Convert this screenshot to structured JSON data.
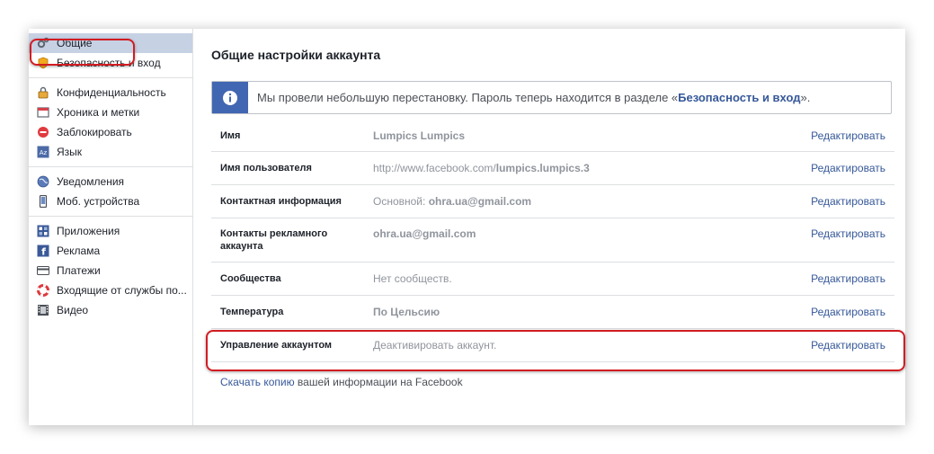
{
  "sidebar": {
    "groups": [
      [
        {
          "label": "Общие",
          "icon": "gear-icon",
          "active": true
        },
        {
          "label": "Безопасность и вход",
          "icon": "shield-icon"
        }
      ],
      [
        {
          "label": "Конфиденциальность",
          "icon": "lock-icon"
        },
        {
          "label": "Хроника и метки",
          "icon": "timeline-icon"
        },
        {
          "label": "Заблокировать",
          "icon": "block-icon"
        },
        {
          "label": "Язык",
          "icon": "language-icon"
        }
      ],
      [
        {
          "label": "Уведомления",
          "icon": "globe-icon"
        },
        {
          "label": "Моб. устройства",
          "icon": "phone-icon"
        }
      ],
      [
        {
          "label": "Приложения",
          "icon": "apps-icon"
        },
        {
          "label": "Реклама",
          "icon": "ads-icon"
        },
        {
          "label": "Платежи",
          "icon": "card-icon"
        },
        {
          "label": "Входящие от службы по...",
          "icon": "lifebuoy-icon"
        },
        {
          "label": "Видео",
          "icon": "film-icon"
        }
      ]
    ]
  },
  "main": {
    "title": "Общие настройки аккаунта",
    "notice": {
      "text_before": "Мы провели небольшую перестановку. Пароль теперь находится в разделе «",
      "link": "Безопасность и вход",
      "text_after": "».",
      "icon": "info-icon"
    },
    "edit_label": "Редактировать",
    "rows": [
      {
        "label": "Имя",
        "value": "Lumpics Lumpics"
      },
      {
        "label": "Имя пользователя",
        "value_prefix": "http://www.facebook.com/",
        "value_bold": "lumpics.lumpics.3"
      },
      {
        "label": "Контактная информация",
        "value_prefix": "Основной: ",
        "value_bold": "ohra.ua@gmail.com"
      },
      {
        "label": "Контакты рекламного аккаунта",
        "value": "ohra.ua@gmail.com"
      },
      {
        "label": "Сообщества",
        "value": "Нет сообществ."
      },
      {
        "label": "Температура",
        "value": "По Цельсию"
      },
      {
        "label": "Управление аккаунтом",
        "value": "Деактивировать аккаунт."
      }
    ],
    "footer": {
      "link": "Скачать копию",
      "text": " вашей информации на Facebook"
    }
  },
  "colors": {
    "accent": "#4267b2",
    "link": "#365899",
    "highlight": "#d21c22",
    "active_bg": "#c7d1e4"
  }
}
